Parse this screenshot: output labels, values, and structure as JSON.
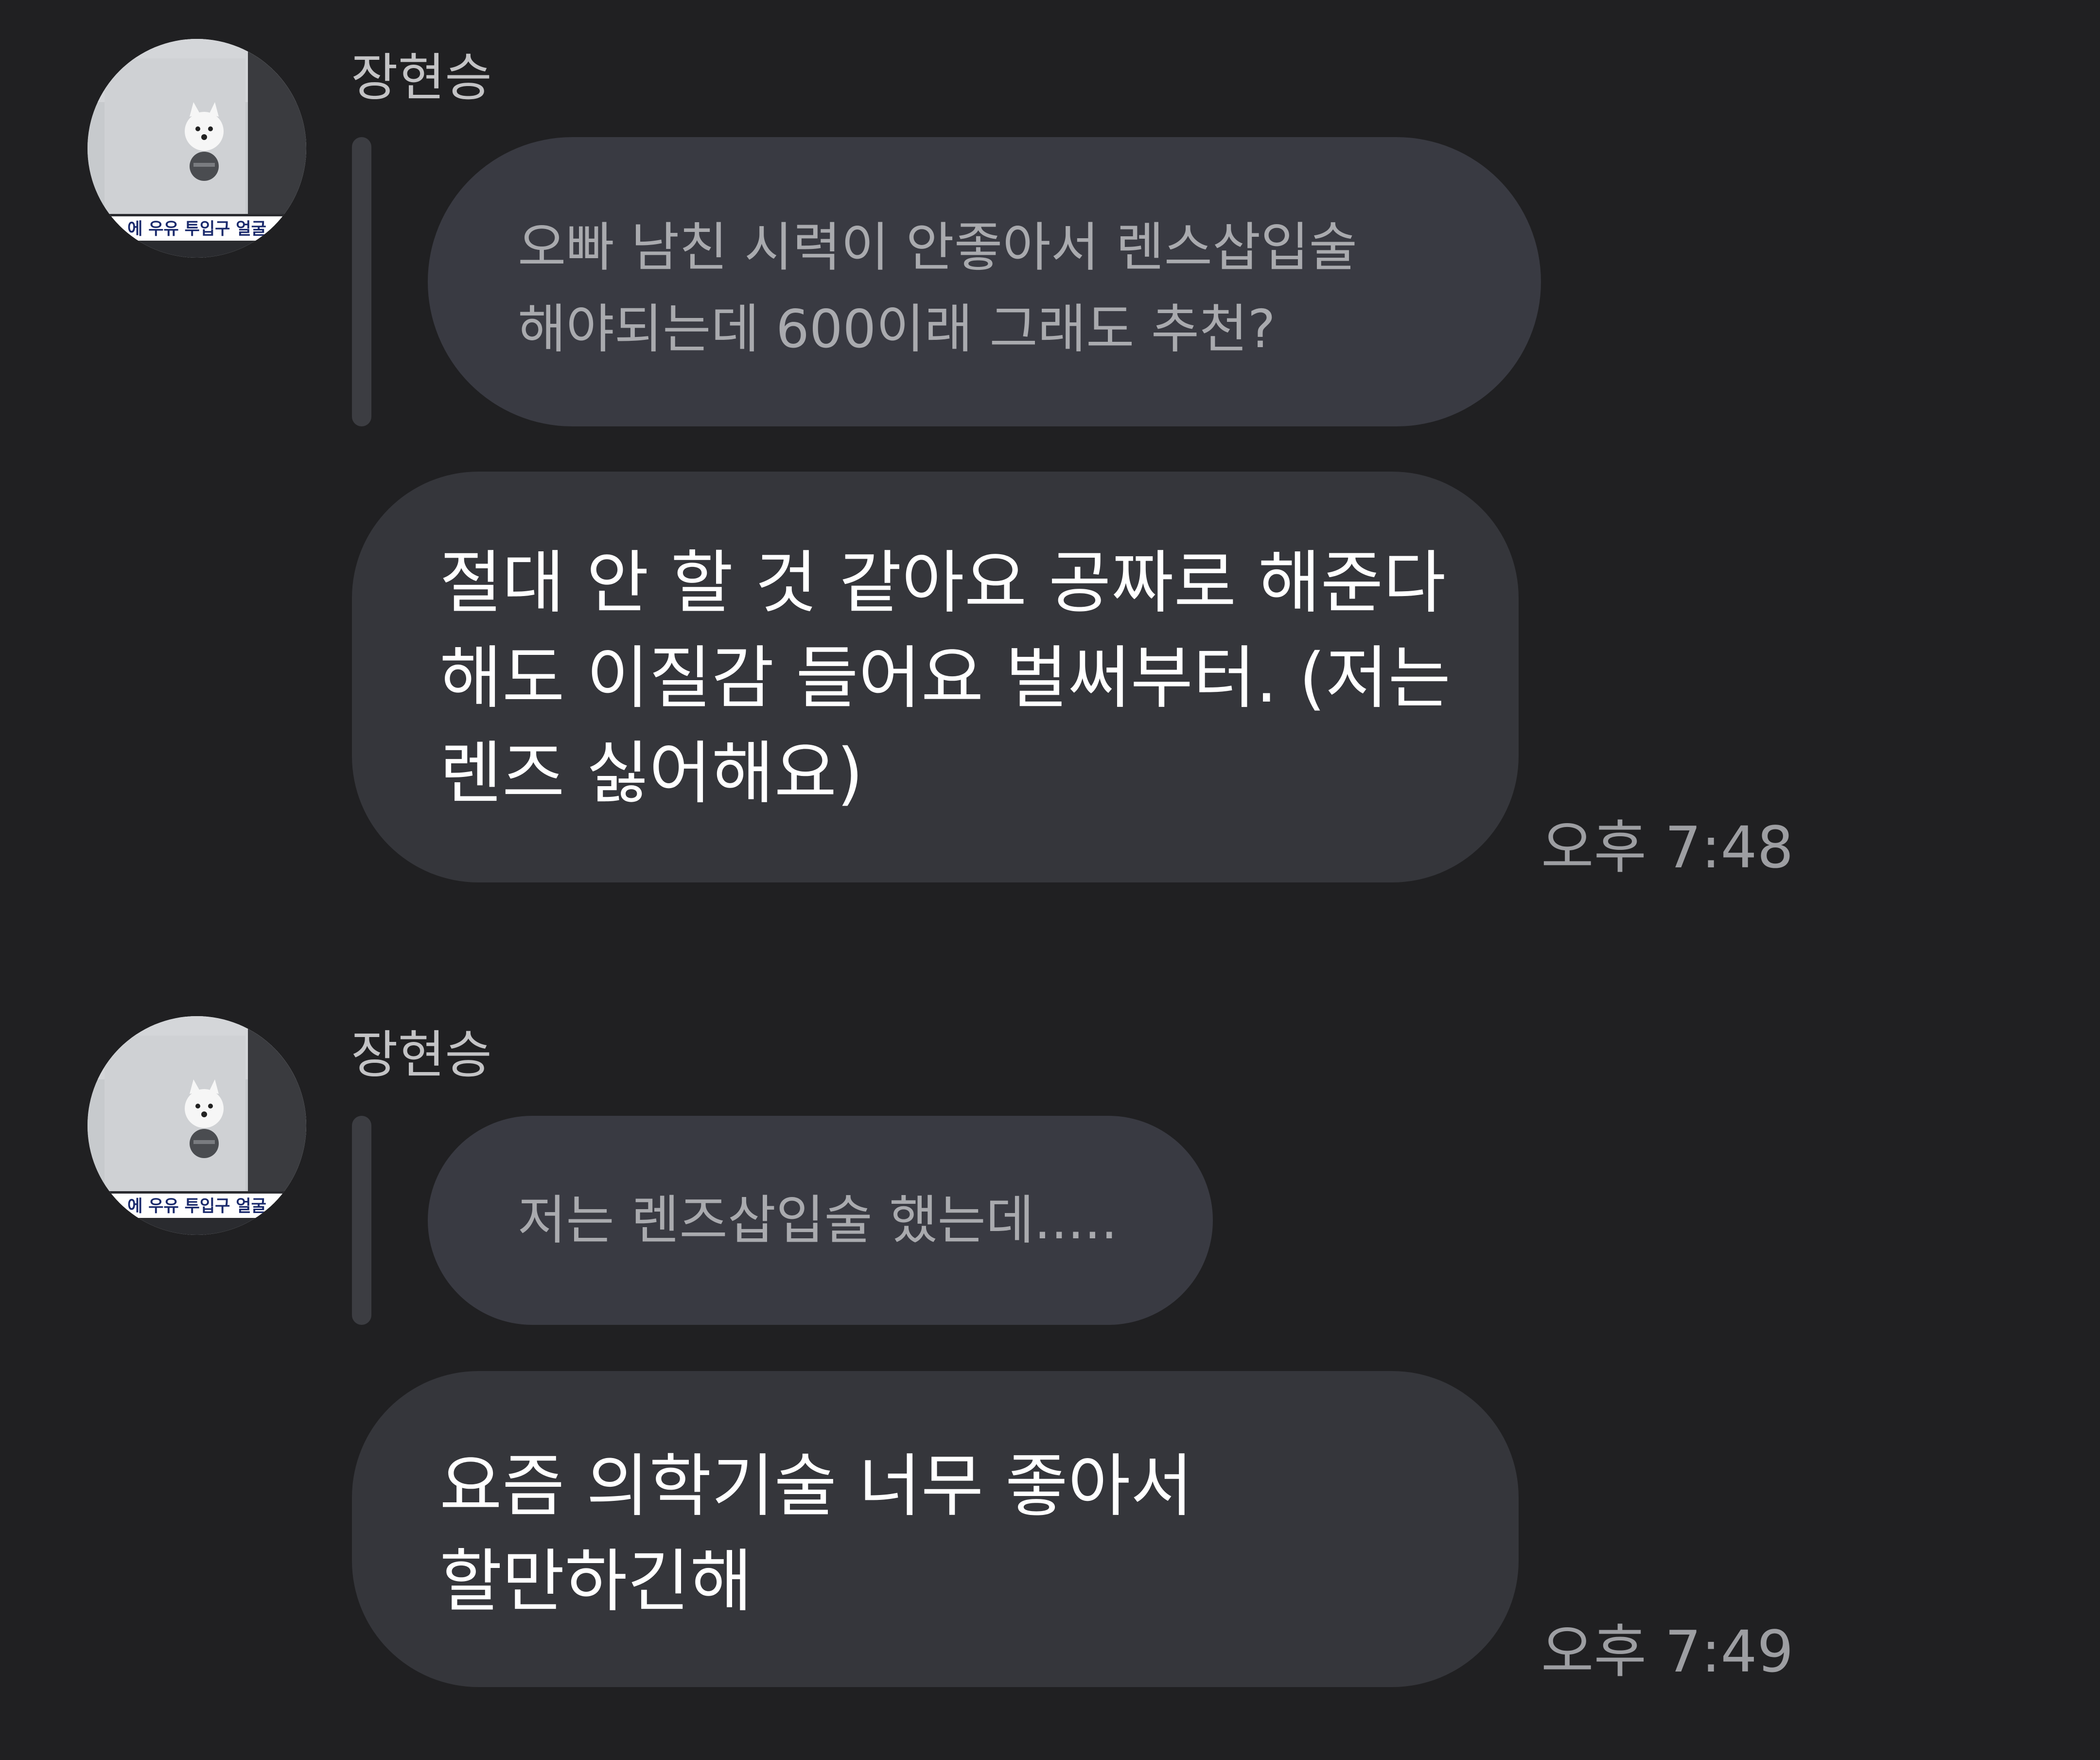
{
  "messages": [
    {
      "sender": "장현승",
      "avatar_caption": "에 우유 투입구 얼굴",
      "quote": "오빠 남친 시력이 안좋아서 렌스삽입술\n해야되는데 600이래 그래도 추천?",
      "text": "절대 안 할 것 같아요 공짜로 해준다\n해도 이질감 들어요 벌써부터. (저는\n렌즈 싫어해요)",
      "time": "오후 7:48"
    },
    {
      "sender": "장현승",
      "avatar_caption": "에 우유 투입구 얼굴",
      "quote": "저는 렌즈삽입술 했는데.....",
      "text": "요즘 의학기술 너무 좋아서\n할만하긴해",
      "time": "오후 7:49"
    }
  ],
  "colors": {
    "background": "#202022",
    "quote_bubble": "#393a42",
    "message_bubble": "#35363b",
    "reply_bar": "#3c3d42",
    "sender_text": "#c3c3c5",
    "quote_text": "#a9aaae",
    "message_text": "#ffffff",
    "time_text": "#9d9ea2"
  },
  "icons": {
    "avatar": "profile-photo-dog-mailslot"
  }
}
